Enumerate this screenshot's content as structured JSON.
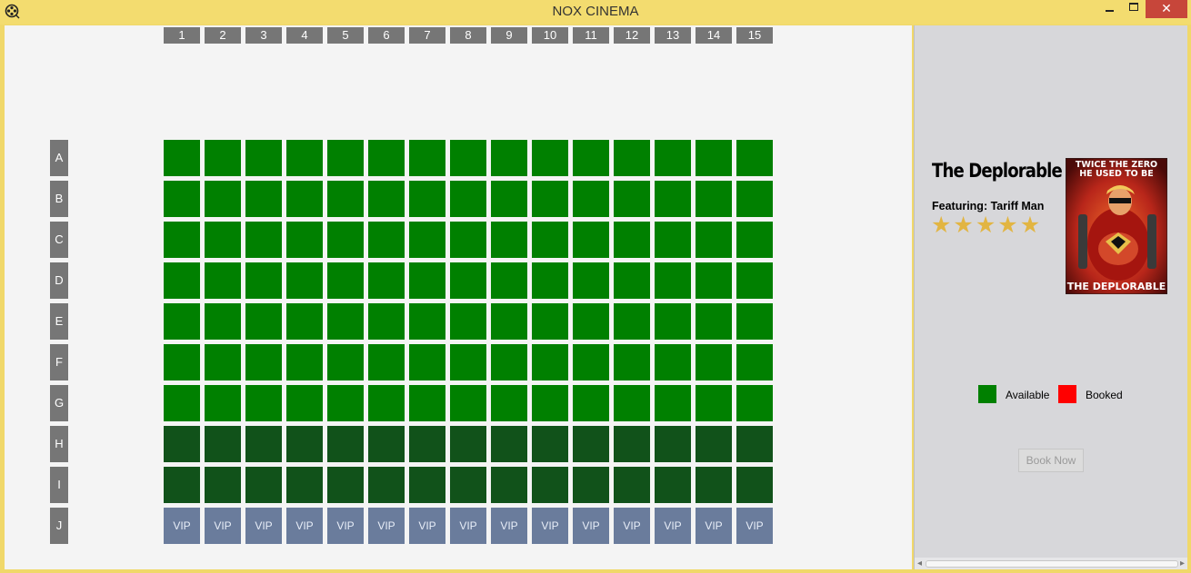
{
  "window": {
    "title": "NOX CINEMA",
    "close_glyph": "✕",
    "icon": "film-reel-icon"
  },
  "seating": {
    "columns": [
      "1",
      "2",
      "3",
      "4",
      "5",
      "6",
      "7",
      "8",
      "9",
      "10",
      "11",
      "12",
      "13",
      "14",
      "15"
    ],
    "rows": [
      "A",
      "B",
      "C",
      "D",
      "E",
      "F",
      "G",
      "H",
      "I",
      "J"
    ],
    "row_status": [
      "available",
      "available",
      "available",
      "available",
      "available",
      "available",
      "available",
      "premium",
      "premium",
      "vip"
    ],
    "vip_label": "VIP"
  },
  "movie": {
    "title": "The Deplorable",
    "featuring": "Featuring: Tariff Man",
    "rating": 5,
    "poster_top_text_1": "TWICE THE ZERO",
    "poster_top_text_2": "HE USED TO BE",
    "poster_bottom_text": "THE DEPLORABLE"
  },
  "legend": {
    "available_label": "Available",
    "booked_label": "Booked"
  },
  "actions": {
    "book_now_label": "Book Now"
  },
  "colors": {
    "available": "#008000",
    "premium": "#11521a",
    "vip": "#6a7c9c",
    "booked": "#ff0000",
    "header": "#767676",
    "titlebar": "#f3dc6f"
  }
}
